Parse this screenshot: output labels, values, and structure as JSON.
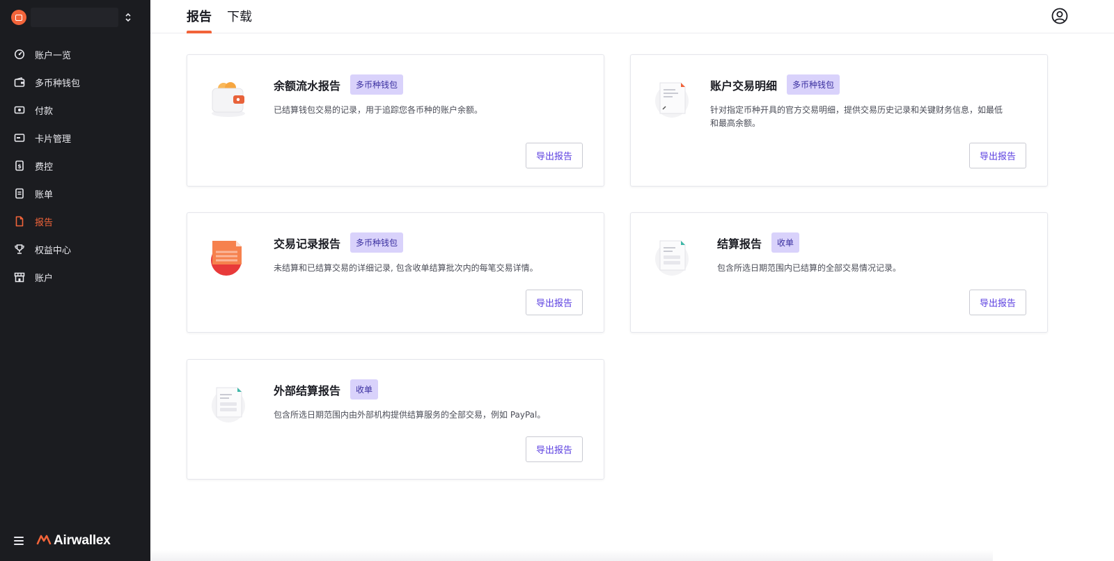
{
  "sidebar": {
    "items": [
      {
        "label": "账户一览",
        "icon": "dashboard-icon"
      },
      {
        "label": "多币种钱包",
        "icon": "wallet-icon"
      },
      {
        "label": "付款",
        "icon": "payment-icon"
      },
      {
        "label": "卡片管理",
        "icon": "card-icon"
      },
      {
        "label": "费控",
        "icon": "expense-icon"
      },
      {
        "label": "账单",
        "icon": "bill-icon"
      },
      {
        "label": "报告",
        "icon": "report-icon",
        "active": true
      },
      {
        "label": "权益中心",
        "icon": "trophy-icon"
      },
      {
        "label": "账户",
        "icon": "store-icon"
      }
    ],
    "brand": "Airwallex"
  },
  "header": {
    "tabs": [
      {
        "label": "报告",
        "active": true
      },
      {
        "label": "下载",
        "active": false
      }
    ]
  },
  "cards": [
    {
      "title": "余额流水报告",
      "badge": "多币种钱包",
      "description": "已结算钱包交易的记录，用于追踪您各币种的账户余额。",
      "button": "导出报告",
      "icon": "wallet-illustration-icon"
    },
    {
      "title": "账户交易明细",
      "badge": "多币种钱包",
      "description_line1": "针对指定币种开具的官方交易明细，提供交易历史记录和关键财务信息，如最低",
      "description_line2": "和最高余额。",
      "button": "导出报告",
      "icon": "statement-illustration-icon"
    },
    {
      "title": "交易记录报告",
      "badge": "多币种钱包",
      "description": "未结算和已结算交易的详细记录, 包含收单结算批次内的每笔交易详情。",
      "button": "导出报告",
      "icon": "transaction-illustration-icon"
    },
    {
      "title": "结算报告",
      "badge": "收单",
      "description": "包含所选日期范围内已结算的全部交易情况记录。",
      "button": "导出报告",
      "icon": "settlement-illustration-icon"
    },
    {
      "title": "外部结算报告",
      "badge": "收单",
      "description": "包含所选日期范围内由外部机构提供结算服务的全部交易，例如 PayPal。",
      "button": "导出报告",
      "icon": "external-settlement-illustration-icon"
    }
  ],
  "colors": {
    "sidebar_bg": "#1b1c20",
    "accent": "#f2643a",
    "badge_bg": "#d9d2fb",
    "button_text": "#5b3fe0"
  }
}
